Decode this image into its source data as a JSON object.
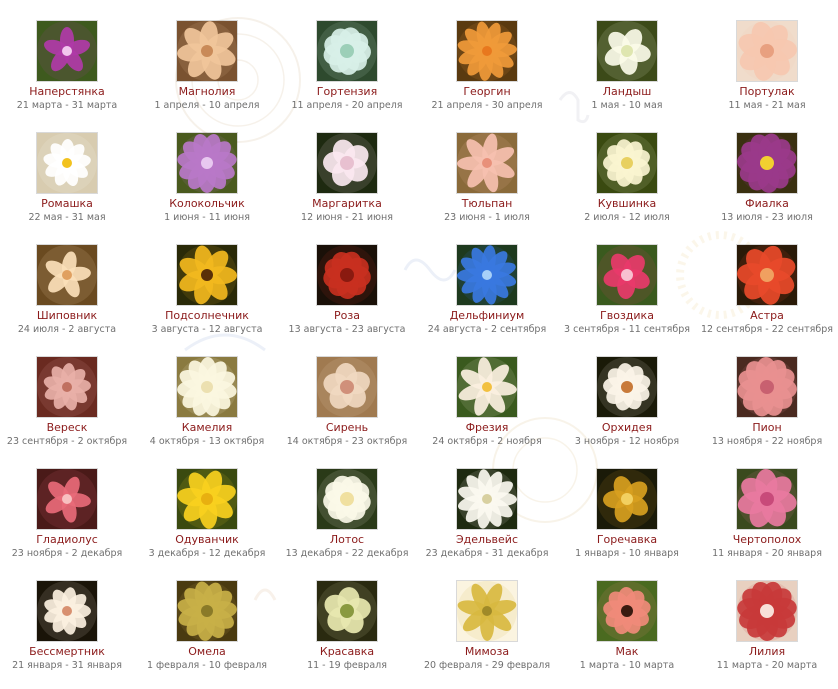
{
  "flowers": [
    {
      "name": "Наперстянка",
      "dates": "21 марта - 31 марта",
      "icon": "foxglove-photo",
      "bg": "#3e5a1e",
      "petal": "#b03aa8",
      "center": "#f2c6ee"
    },
    {
      "name": "Магнолия",
      "dates": "1 апреля - 10 апреля",
      "icon": "magnolia-photo",
      "bg": "#7a5230",
      "petal": "#f0c69a",
      "center": "#c98a58"
    },
    {
      "name": "Гортензия",
      "dates": "11 апреля - 20 апреля",
      "icon": "hydrangea-photo",
      "bg": "#2e4a2e",
      "petal": "#d8f0e8",
      "center": "#9ccfb8"
    },
    {
      "name": "Георгин",
      "dates": "21 апреля - 30 апреля",
      "icon": "dahlia-photo",
      "bg": "#5a3a10",
      "petal": "#f09a3a",
      "center": "#e8781e"
    },
    {
      "name": "Ландыш",
      "dates": "1 мая - 10 мая",
      "icon": "lily-of-the-valley-photo",
      "bg": "#3c4a18",
      "petal": "#fbfbe8",
      "center": "#dfe6b0"
    },
    {
      "name": "Портулак",
      "dates": "11 мая - 21 мая",
      "icon": "portulaca-photo",
      "bg": "#f0dccb",
      "petal": "#f6c8b0",
      "center": "#e8a080"
    },
    {
      "name": "Ромашка",
      "dates": "22 мая - 31 мая",
      "icon": "chamomile-photo",
      "bg": "#d8ccb0",
      "petal": "#ffffff",
      "center": "#f2c21e"
    },
    {
      "name": "Колокольчик",
      "dates": "1 июня - 11 июня",
      "icon": "bellflower-photo",
      "bg": "#4a5a1e",
      "petal": "#b878c8",
      "center": "#e8c8f0"
    },
    {
      "name": "Маргаритка",
      "dates": "12 июня - 21 июня",
      "icon": "daisy-photo",
      "bg": "#1e2a10",
      "petal": "#fbe8f0",
      "center": "#e8c0d0"
    },
    {
      "name": "Тюльпан",
      "dates": "23 июня - 1 июля",
      "icon": "tulip-photo",
      "bg": "#8a6a3a",
      "petal": "#f6c0b0",
      "center": "#e8907a"
    },
    {
      "name": "Кувшинка",
      "dates": "2 июля - 12 июля",
      "icon": "water-lily-photo",
      "bg": "#3a4a10",
      "petal": "#faf4d0",
      "center": "#e8d060"
    },
    {
      "name": "Фиалка",
      "dates": "13 июля - 23 июля",
      "icon": "violet-photo",
      "bg": "#3a3010",
      "petal": "#9a3a8a",
      "center": "#f2d030"
    },
    {
      "name": "Шиповник",
      "dates": "24 июля - 2 августа",
      "icon": "dog-rose-photo",
      "bg": "#6a4a20",
      "petal": "#fbe0b8",
      "center": "#e0a060"
    },
    {
      "name": "Подсолнечник",
      "dates": "3 августа - 12 августа",
      "icon": "sunflower-photo",
      "bg": "#2a2a08",
      "petal": "#f2b81e",
      "center": "#5a3008"
    },
    {
      "name": "Роза",
      "dates": "13 августа - 23 августа",
      "icon": "rose-photo",
      "bg": "#1a1008",
      "petal": "#c83020",
      "center": "#8a1a10"
    },
    {
      "name": "Дельфиниум",
      "dates": "24 августа - 2 сентября",
      "icon": "delphinium-photo",
      "bg": "#1e3a1e",
      "petal": "#3a78e0",
      "center": "#a8d0f8"
    },
    {
      "name": "Гвоздика",
      "dates": "3 сентября - 11 сентября",
      "icon": "carnation-photo",
      "bg": "#3a5a1e",
      "petal": "#e83a6a",
      "center": "#f8c0d0"
    },
    {
      "name": "Астра",
      "dates": "12 сентября - 22 сентября",
      "icon": "aster-photo",
      "bg": "#2a1a08",
      "petal": "#e84a2a",
      "center": "#f0a060"
    },
    {
      "name": "Вереск",
      "dates": "23 сентября - 2 октября",
      "icon": "heather-photo",
      "bg": "#6a2a20",
      "petal": "#e8b0a8",
      "center": "#c07060"
    },
    {
      "name": "Камелия",
      "dates": "4 октября - 13 октября",
      "icon": "camellia-photo",
      "bg": "#8a7a40",
      "petal": "#fbf6e0",
      "center": "#ece0b0"
    },
    {
      "name": "Сирень",
      "dates": "14 октября - 23 октября",
      "icon": "lilac-photo",
      "bg": "#a07a50",
      "petal": "#f0d8c0",
      "center": "#d0907a"
    },
    {
      "name": "Фрезия",
      "dates": "24 октября - 2 ноября",
      "icon": "freesia-photo",
      "bg": "#3a5a1e",
      "petal": "#fbf0e0",
      "center": "#f2c040"
    },
    {
      "name": "Орхидея",
      "dates": "3 ноября - 12 ноября",
      "icon": "orchid-photo",
      "bg": "#1a1a08",
      "petal": "#fbf4e8",
      "center": "#c87a3a"
    },
    {
      "name": "Пион",
      "dates": "13 ноября - 22 ноября",
      "icon": "peony-photo",
      "bg": "#4a2a20",
      "petal": "#e89090",
      "center": "#c86070"
    },
    {
      "name": "Гладиолус",
      "dates": "23 ноября - 2 декабря",
      "icon": "gladiolus-photo",
      "bg": "#4a1a18",
      "petal": "#e86a78",
      "center": "#f8c0c0"
    },
    {
      "name": "Одуванчик",
      "dates": "3 декабря - 12 декабря",
      "icon": "dandelion-photo",
      "bg": "#3a4a10",
      "petal": "#f8d01e",
      "center": "#e8b010"
    },
    {
      "name": "Лотос",
      "dates": "13 декабря - 22 декабря",
      "icon": "lotus-photo",
      "bg": "#2a3a18",
      "petal": "#fbf8e8",
      "center": "#f0e0a0"
    },
    {
      "name": "Эдельвейс",
      "dates": "23 декабря - 31 декабря",
      "icon": "edelweiss-photo",
      "bg": "#1e2a10",
      "petal": "#fbf8f0",
      "center": "#d8d0a0"
    },
    {
      "name": "Горечавка",
      "dates": "1 января - 10 января",
      "icon": "gentian-photo",
      "bg": "#1a1a08",
      "petal": "#d8a020",
      "center": "#f2d060"
    },
    {
      "name": "Чертополох",
      "dates": "11 января - 20 января",
      "icon": "thistle-photo",
      "bg": "#3a4a1e",
      "petal": "#e87aa0",
      "center": "#c84a7a"
    },
    {
      "name": "Бессмертник",
      "dates": "21 января - 31 января",
      "icon": "immortelle-photo",
      "bg": "#1a1408",
      "petal": "#fbf0e0",
      "center": "#d89070"
    },
    {
      "name": "Омела",
      "dates": "1 февраля - 10 февраля",
      "icon": "mistletoe-photo",
      "bg": "#4a3a10",
      "petal": "#c8b048",
      "center": "#8a7a28"
    },
    {
      "name": "Красавка",
      "dates": "11 - 19 февраля",
      "icon": "belladonna-photo",
      "bg": "#2a2a10",
      "petal": "#e8e8b0",
      "center": "#8a9a40"
    },
    {
      "name": "Мимоза",
      "dates": "20 февраля - 29 февраля",
      "icon": "mimosa-photo",
      "bg": "#fbf4e0",
      "petal": "#d8b840",
      "center": "#a08a28"
    },
    {
      "name": "Мак",
      "dates": "1 марта - 10 марта",
      "icon": "poppy-photo",
      "bg": "#4a6a20",
      "petal": "#f08a7a",
      "center": "#3a1a10"
    },
    {
      "name": "Лилия",
      "dates": "11 марта - 20 марта",
      "icon": "lily-photo",
      "bg": "#e8d0c0",
      "petal": "#c83a3a",
      "center": "#f8e0d8"
    }
  ]
}
